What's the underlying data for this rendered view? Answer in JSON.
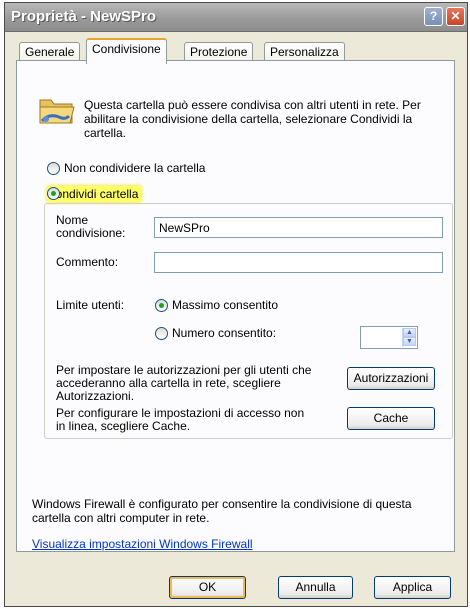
{
  "window": {
    "title": "Proprietà - NewSPro",
    "help_label": "?",
    "close_label": "✕"
  },
  "tabs": [
    {
      "label": "Generale",
      "active": false
    },
    {
      "label": "Condivisione",
      "active": true
    },
    {
      "label": "Protezione",
      "active": false
    },
    {
      "label": "Personalizza",
      "active": false
    }
  ],
  "share": {
    "intro": "Questa cartella può essere condivisa con altri utenti in rete. Per abilitare la condivisione della cartella, selezionare Condividi la cartella.",
    "no_share_label": "Non condividere la cartella",
    "share_label": "Condividi cartella",
    "share_selected": true,
    "share_name_label": "Nome condivisione:",
    "share_name_value": "NewSPro",
    "comment_label": "Commento:",
    "comment_value": "",
    "user_limit_label": "Limite utenti:",
    "max_allowed_label": "Massimo consentito",
    "max_allowed_selected": true,
    "number_allowed_label": "Numero consentito:",
    "number_allowed_value": "",
    "permissions_text": "Per impostare le autorizzazioni per gli utenti che accederanno alla cartella in rete, scegliere Autorizzazioni.",
    "permissions_button": "Autorizzazioni",
    "cache_text": "Per configurare le impostazioni di accesso non in linea, scegliere Cache.",
    "cache_button": "Cache"
  },
  "firewall": {
    "text": "Windows Firewall è configurato per consentire la condivisione di questa cartella con altri computer in rete.",
    "link": "Visualizza impostazioni Windows Firewall"
  },
  "buttons": {
    "ok": "OK",
    "cancel": "Annulla",
    "apply": "Applica"
  },
  "colors": {
    "highlight": "#ffff66",
    "active_tab_accent": "#e8a431",
    "link": "#0033cc"
  }
}
